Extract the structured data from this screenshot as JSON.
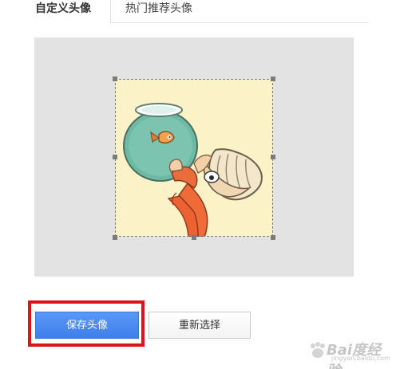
{
  "tabs": [
    {
      "label": "自定义头像",
      "active": true
    },
    {
      "label": "热门推荐头像",
      "active": false
    }
  ],
  "actions": {
    "save_label": "保存头像",
    "reselect_label": "重新选择"
  },
  "watermark": {
    "main": "Bai度经验",
    "sub": "jingyan.baidu.com"
  },
  "colors": {
    "primary_button": "#4a8af4",
    "highlight_box": "#e0111b",
    "crop_background": "#e3e3e3"
  }
}
